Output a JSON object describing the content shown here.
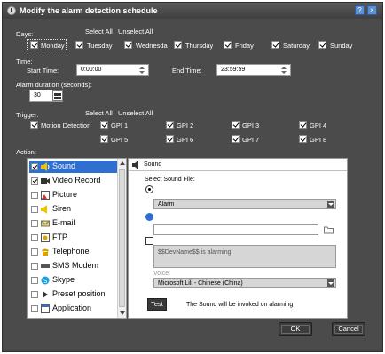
{
  "window": {
    "title": "Modify the alarm detection schedule",
    "help_icon": "help-icon",
    "close_icon": "close-icon"
  },
  "days": {
    "label": "Days:",
    "select_all": "Select All",
    "unselect_all": "Unselect All",
    "items": [
      {
        "label": "Monday",
        "checked": true
      },
      {
        "label": "Tuesday",
        "checked": true
      },
      {
        "label": "Wednesda",
        "checked": true
      },
      {
        "label": "Thursday",
        "checked": true
      },
      {
        "label": "Friday",
        "checked": true
      },
      {
        "label": "Saturday",
        "checked": true
      },
      {
        "label": "Sunday",
        "checked": true
      }
    ]
  },
  "time": {
    "label": "Time:",
    "start_label": "Start Time:",
    "start_value": "0:00:00",
    "end_label": "End Time:",
    "end_value": "23:59:59"
  },
  "alarm_duration": {
    "label": "Alarm duration (seconds):",
    "value": "30"
  },
  "trigger": {
    "label": "Trigger:",
    "select_all": "Select All",
    "unselect_all": "Unselect All",
    "motion_detection": "Motion Detection",
    "gpi": [
      "GPI 1",
      "GPI 2",
      "GPI 3",
      "GPI 4",
      "GPI 5",
      "GPI 6",
      "GPI 7",
      "GPI 8"
    ]
  },
  "action": {
    "label": "Action:",
    "items": [
      {
        "label": "Sound",
        "checked": true,
        "icon": "speaker-icon",
        "selected": true
      },
      {
        "label": "Video Record",
        "checked": true,
        "icon": "camcorder-icon",
        "selected": false
      },
      {
        "label": "Picture",
        "checked": false,
        "icon": "picture-icon",
        "selected": false
      },
      {
        "label": "Siren",
        "checked": false,
        "icon": "siren-icon",
        "selected": false
      },
      {
        "label": "E-mail",
        "checked": false,
        "icon": "envelope-icon",
        "selected": false
      },
      {
        "label": "FTP",
        "checked": false,
        "icon": "ftp-icon",
        "selected": false
      },
      {
        "label": "Telephone",
        "checked": false,
        "icon": "telephone-icon",
        "selected": false
      },
      {
        "label": "SMS Modem",
        "checked": false,
        "icon": "modem-icon",
        "selected": false
      },
      {
        "label": "Skype",
        "checked": false,
        "icon": "skype-icon",
        "selected": false
      },
      {
        "label": "Preset position",
        "checked": false,
        "icon": "preset-icon",
        "selected": false
      },
      {
        "label": "Application",
        "checked": false,
        "icon": "application-icon",
        "selected": false
      }
    ]
  },
  "sound_panel": {
    "header": "Sound",
    "select_label": "Select Sound File:",
    "alarm_value": "Alarm",
    "text_value": "$$DevName$$ is alarming",
    "voice_label": "Voice:",
    "voice_value": "Microsoft Lili - Chinese (China)",
    "test_label": "Test",
    "note": "The Sound will be invoked on alarming"
  },
  "buttons": {
    "ok": "OK",
    "cancel": "Cancel"
  },
  "colors": {
    "background": "#4b4b4b",
    "selection": "#2f6fd0",
    "titlebar_button": "#5b8fd0"
  }
}
